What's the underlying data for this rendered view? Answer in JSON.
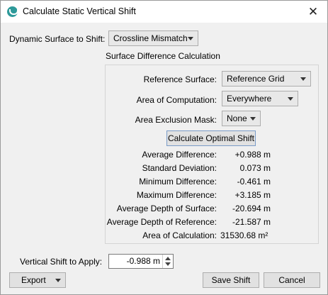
{
  "window": {
    "title": "Calculate Static Vertical Shift"
  },
  "form": {
    "dynamic_surface_label": "Dynamic Surface to Shift:",
    "dynamic_surface_value": "Crossline Mismatch",
    "section_title": "Surface Difference Calculation",
    "reference_surface_label": "Reference Surface:",
    "reference_surface_value": "Reference Grid",
    "area_label": "Area of Computation:",
    "area_value": "Everywhere",
    "mask_label": "Area Exclusion Mask:",
    "mask_value": "None",
    "calculate_button": "Calculate Optimal Shift"
  },
  "stats": [
    {
      "label": "Average Difference:",
      "value": "+0.988 m"
    },
    {
      "label": "Standard Deviation:",
      "value": "0.073 m"
    },
    {
      "label": "Minimum Difference:",
      "value": "-0.461 m"
    },
    {
      "label": "Maximum Difference:",
      "value": "+3.185 m"
    },
    {
      "label": "Average Depth of Surface:",
      "value": "-20.694 m"
    },
    {
      "label": "Average Depth of Reference:",
      "value": "-21.587 m"
    },
    {
      "label": "Area of Calculation:",
      "value": "31530.68 m²"
    }
  ],
  "shift": {
    "label": "Vertical Shift to Apply:",
    "value": "-0.988 m"
  },
  "buttons": {
    "export": "Export",
    "save": "Save Shift",
    "cancel": "Cancel"
  },
  "icons": {
    "app": "survey-app-icon",
    "close": "close-icon",
    "dropdown": "chevron-down-icon"
  }
}
